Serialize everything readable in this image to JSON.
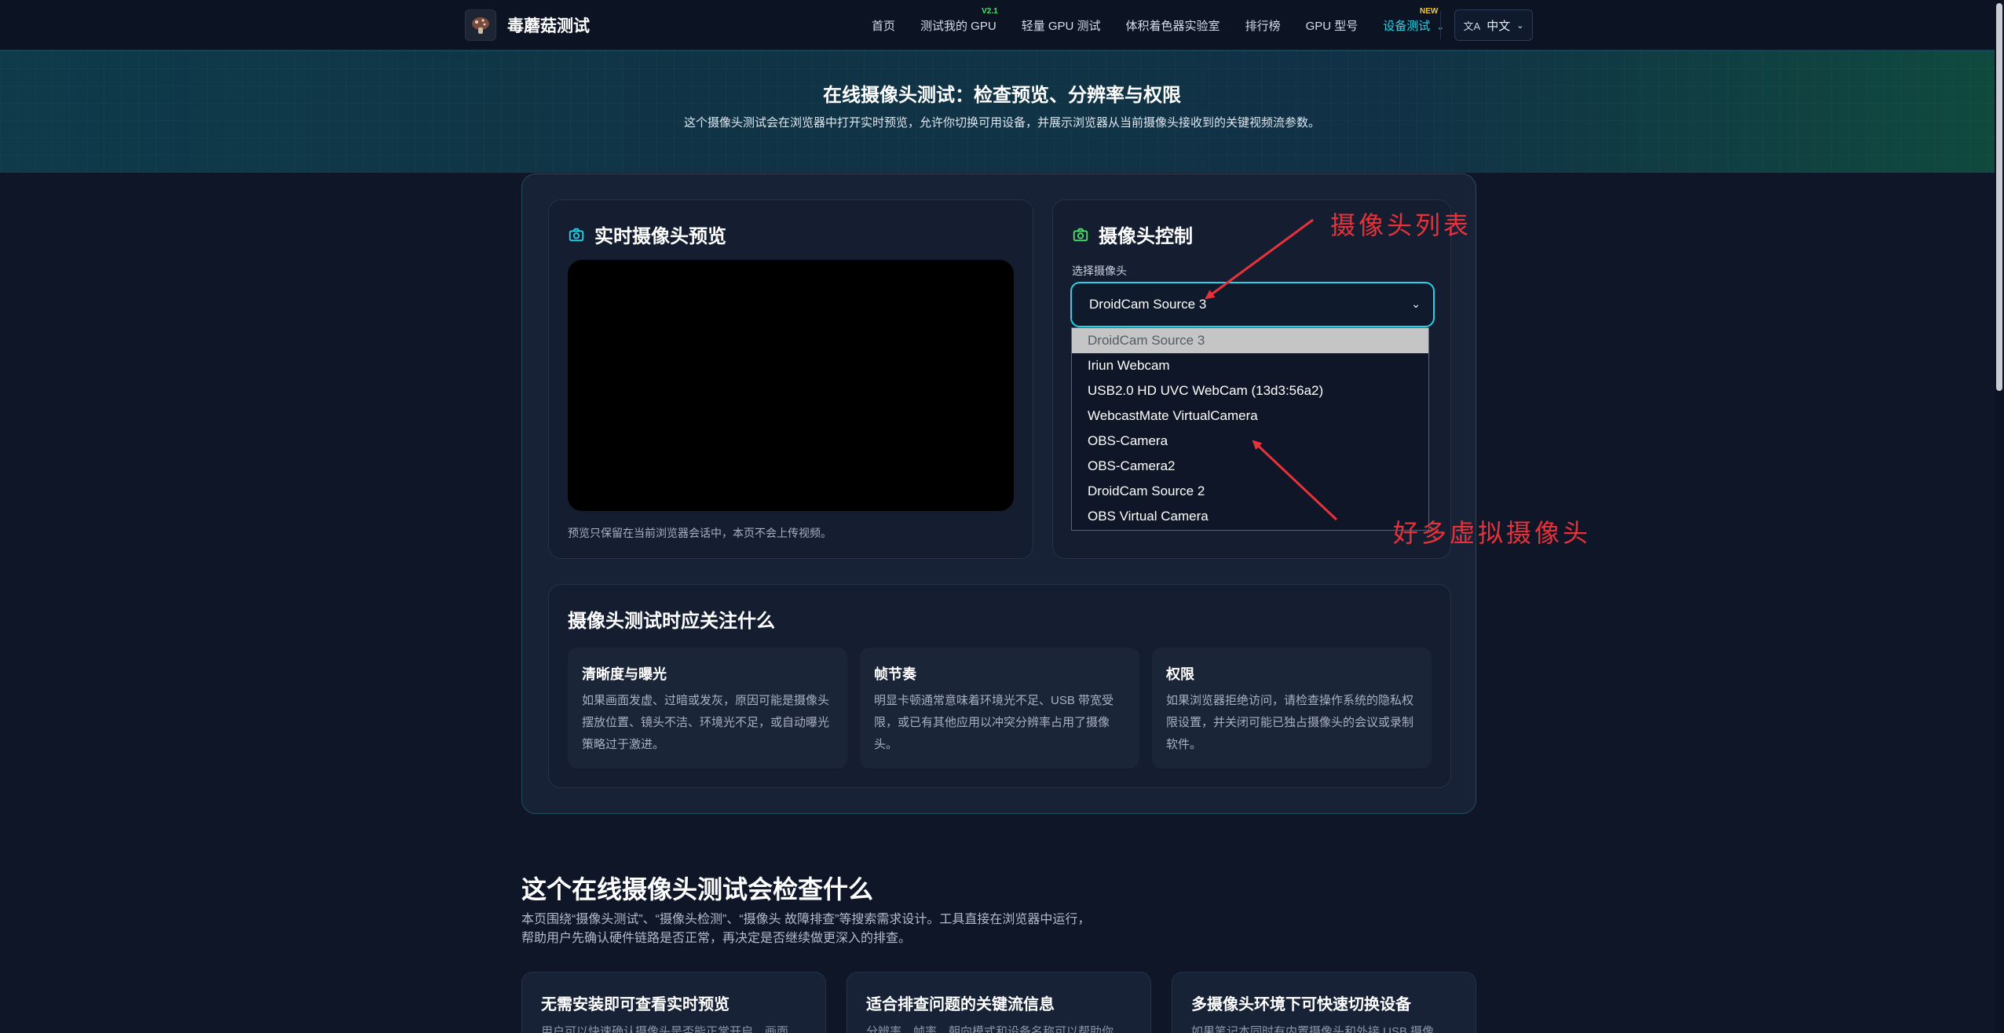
{
  "header": {
    "brand": "毒蘑菇测试",
    "nav": [
      {
        "label": "首页"
      },
      {
        "label": "测试我的 GPU",
        "badge": "V2.1"
      },
      {
        "label": "轻量 GPU 测试"
      },
      {
        "label": "体积着色器实验室"
      },
      {
        "label": "排行榜"
      },
      {
        "label": "GPU 型号"
      },
      {
        "label": "设备测试",
        "badge": "NEW"
      }
    ],
    "lang": "中文"
  },
  "hero": {
    "title": "在线摄像头测试：检查预览、分辨率与权限",
    "subtitle": "这个摄像头测试会在浏览器中打开实时预览，允许你切换可用设备，并展示浏览器从当前摄像头接收到的关键视频流参数。"
  },
  "preview": {
    "title": "实时摄像头预览",
    "note": "预览只保留在当前浏览器会话中，本页不会上传视频。"
  },
  "control": {
    "title": "摄像头控制",
    "label": "选择摄像头",
    "selected": "DroidCam Source 3",
    "options": [
      "DroidCam Source 3",
      "Iriun Webcam",
      "USB2.0 HD UVC WebCam (13d3:56a2)",
      "WebcastMate VirtualCamera",
      "OBS-Camera",
      "OBS-Camera2",
      "DroidCam Source 2",
      "OBS Virtual Camera"
    ]
  },
  "focus": {
    "title": "摄像头测试时应关注什么",
    "tiles": [
      {
        "title": "清晰度与曝光",
        "body": "如果画面发虚、过暗或发灰，原因可能是摄像头摆放位置、镜头不洁、环境光不足，或自动曝光策略过于激进。"
      },
      {
        "title": "帧节奏",
        "body": "明显卡顿通常意味着环境光不足、USB 带宽受限，或已有其他应用以冲突分辨率占用了摄像头。"
      },
      {
        "title": "权限",
        "body": "如果浏览器拒绝访问，请检查操作系统的隐私权限设置，并关闭可能已独占摄像头的会议或录制软件。"
      }
    ]
  },
  "section2": {
    "title": "这个在线摄像头测试会检查什么",
    "body_line1": "本页围绕“摄像头测试”、“摄像头检测”、“摄像头 故障排查”等搜索需求设计。工具直接在浏览器中运行，",
    "body_line2": "帮助用户先确认硬件链路是否正常，再决定是否继续做更深入的排查。",
    "cards": [
      {
        "title": "无需安装即可查看实时预览",
        "body": "用户可以快速确认摄像头是否能正常开启，画面"
      },
      {
        "title": "适合排查问题的关键流信息",
        "body": "分辨率、帧率、朝向模式和设备名称可以帮助你"
      },
      {
        "title": "多摄像头环境下可快速切换设备",
        "body": "如果笔记本同时有内置摄像头和外接 USB 摄像"
      }
    ]
  },
  "annotations": {
    "camera_list": "摄像头列表",
    "many_virtual": "好多虚拟摄像头"
  },
  "colors": {
    "accent": "#27d3e6",
    "annotation": "#e8323a",
    "background": "#0e1628"
  }
}
